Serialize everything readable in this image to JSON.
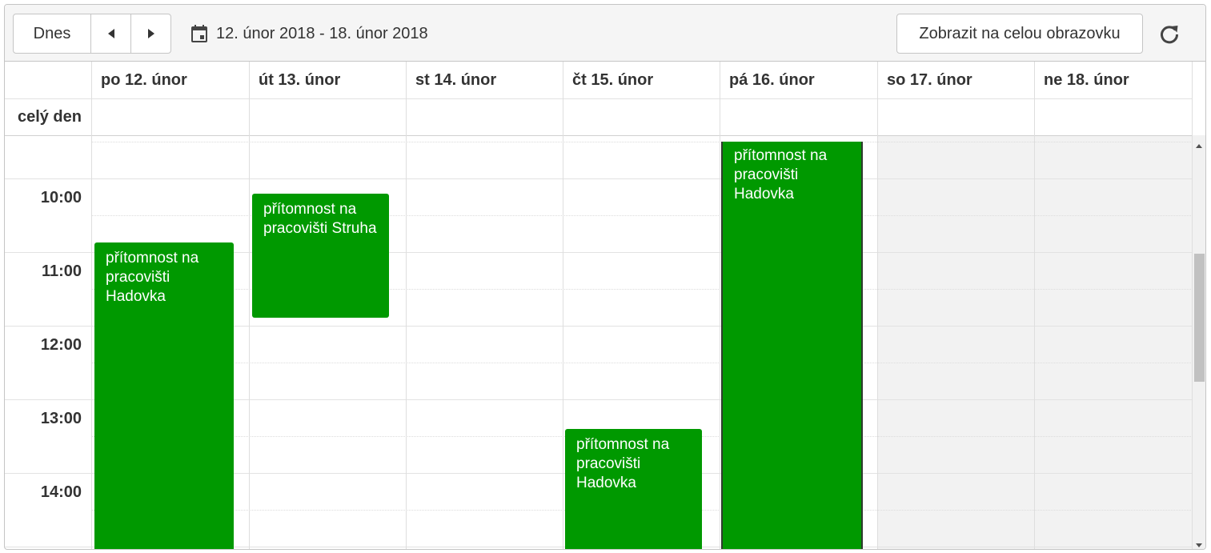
{
  "toolbar": {
    "today_label": "Dnes",
    "date_range": "12. únor 2018 - 18. únor 2018",
    "fullscreen_label": "Zobrazit na celou obrazovku"
  },
  "allday_label": "celý den",
  "days": [
    {
      "label": "po 12. únor"
    },
    {
      "label": "út 13. únor"
    },
    {
      "label": "st 14. únor"
    },
    {
      "label": "čt 15. únor"
    },
    {
      "label": "pá 16. únor"
    },
    {
      "label": "so 17. únor"
    },
    {
      "label": "ne 18. únor"
    }
  ],
  "times": [
    "10:00",
    "11:00",
    "12:00",
    "13:00",
    "14:00"
  ],
  "events": [
    {
      "title": "přítomnost na pracovišti Hadovka",
      "day": "po 12. únor"
    },
    {
      "title": "přítomnost na pracovišti Struha",
      "day": "út 13. únor"
    },
    {
      "title": "přítomnost na pracovišti Hadovka",
      "day": "čt 15. únor"
    },
    {
      "title": "přítomnost na pracovišti Hadovka",
      "day": "pá 16. únor"
    }
  ],
  "colors": {
    "event": "#009900",
    "weekend": "#f2f2f2"
  }
}
